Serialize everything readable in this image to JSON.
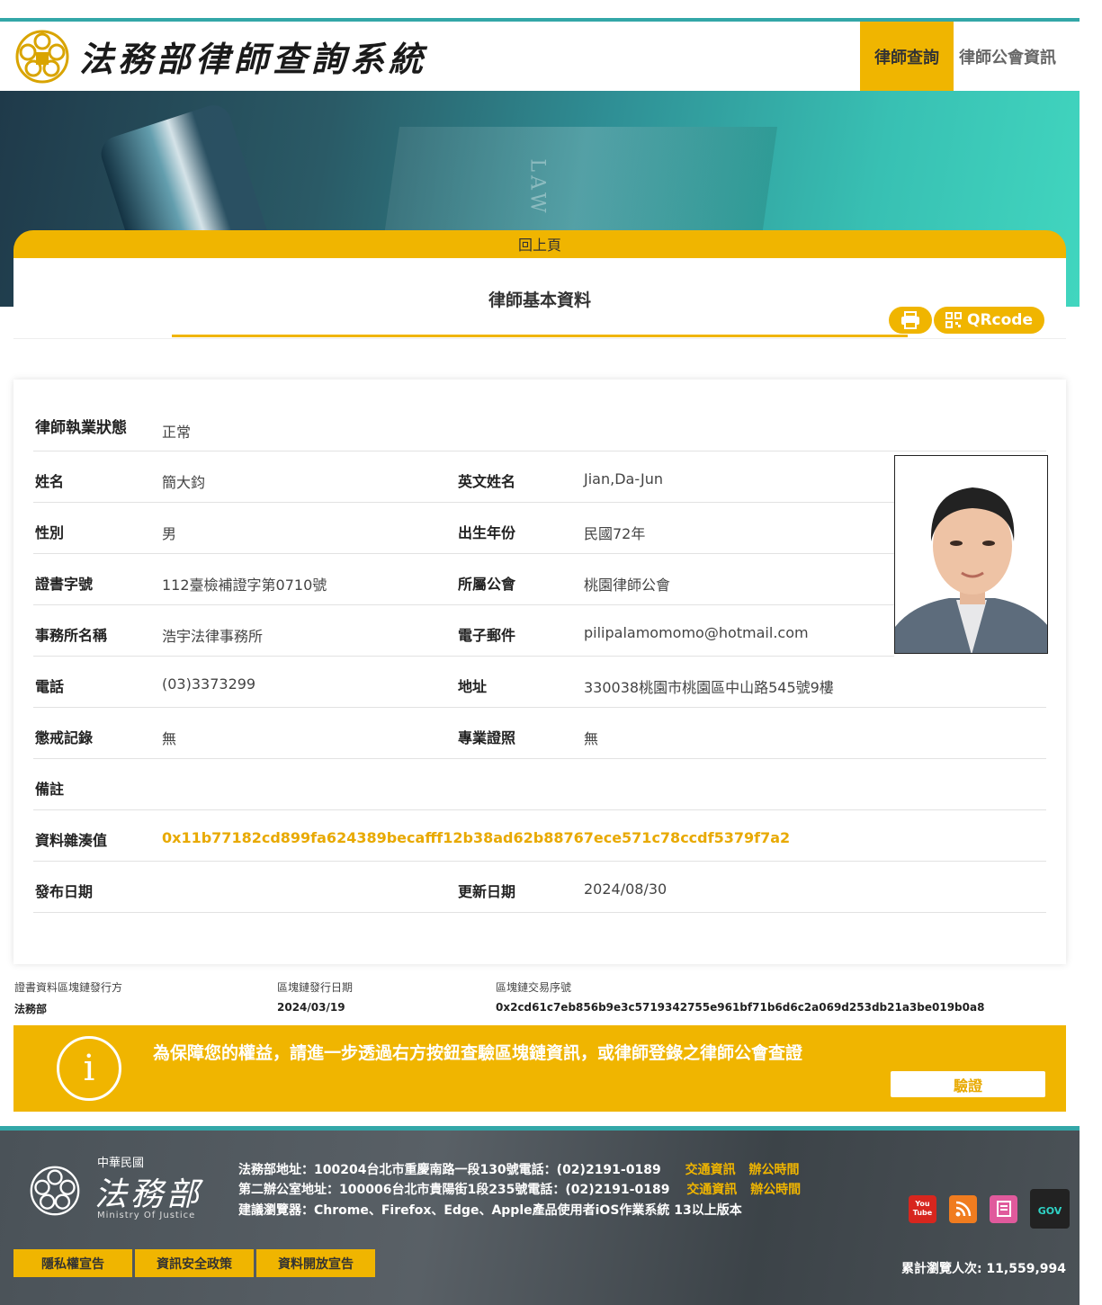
{
  "header": {
    "site_title": "法務部律師查詢系統",
    "nav": [
      {
        "label": "律師查詢"
      },
      {
        "label": "律師公會資訊"
      }
    ]
  },
  "hero": {
    "book_text": "LAW"
  },
  "card": {
    "back_label": "回上頁",
    "title": "律師基本資料",
    "qr_label": "QRcode"
  },
  "profile": {
    "status_label": "律師執業狀態",
    "status_value": "正常",
    "name_label": "姓名",
    "name_value": "簡大鈞",
    "en_name_label": "英文姓名",
    "en_name_value": "Jian,Da-Jun",
    "gender_label": "性別",
    "gender_value": "男",
    "birth_label": "出生年份",
    "birth_value": "民國72年",
    "cert_label": "證書字號",
    "cert_value": "112臺檢補證字第0710號",
    "bar_label": "所屬公會",
    "bar_value": "桃園律師公會",
    "office_label": "事務所名稱",
    "office_value": "浩宇法律事務所",
    "email_label": "電子郵件",
    "email_value": "pilipalamomomo@hotmail.com",
    "phone_label": "電話",
    "phone_value": "(03)3373299",
    "address_label": "地址",
    "address_value": "330038桃園市桃園區中山路545號9樓",
    "discipline_label": "懲戒記錄",
    "discipline_value": "無",
    "specialty_label": "專業證照",
    "specialty_value": "無",
    "note_label": "備註",
    "note_value": "",
    "hash_label": "資料雜湊值",
    "hash_value": "0x11b77182cd899fa624389becafff12b38ad62b88767ece571c78ccdf5379f7a2",
    "publish_label": "發布日期",
    "publish_value": "",
    "update_label": "更新日期",
    "update_value": "2024/08/30"
  },
  "blockchain": {
    "issuer_label": "證書資料區塊鏈發行方",
    "issuer_value": "法務部",
    "date_label": "區塊鏈發行日期",
    "date_value": "2024/03/19",
    "tx_label": "區塊鏈交易序號",
    "tx_value": "0x2cd61c7eb856b9e3c5719342755e961bf71b6d6c2a069d253db21a3be019b0a8"
  },
  "notice": {
    "icon_glyph": "i",
    "text": "為保障您的權益，請進一步透過右方按鈕查驗區塊鏈資訊，或律師登錄之律師公會查證",
    "verify_label": "驗證"
  },
  "footer": {
    "roc": "中華民國",
    "moj": "法務部",
    "moj_en": "Ministry Of Justice",
    "addr1": "法務部地址：100204台北市重慶南路一段130號電話：(02)2191-0189",
    "addr2": "第二辦公室地址：100006台北市貴陽街1段235號電話：(02)2191-0189",
    "browser": "建議瀏覽器：Chrome、Firefox、Edge、Apple產品使用者iOS作業系統 13以上版本",
    "traffic": "交通資訊",
    "hours": "辦公時間",
    "youtube": "You Tube",
    "gov": "GOV",
    "buttons": [
      {
        "label": "隱私權宣告"
      },
      {
        "label": "資訊安全政策"
      },
      {
        "label": "資料開放宣告"
      }
    ],
    "counter": "累計瀏覽人次: 11,559,994"
  },
  "colors": {
    "accent": "#f0b500",
    "teal": "#33a7a8",
    "footer_bg": "#4f565c"
  }
}
